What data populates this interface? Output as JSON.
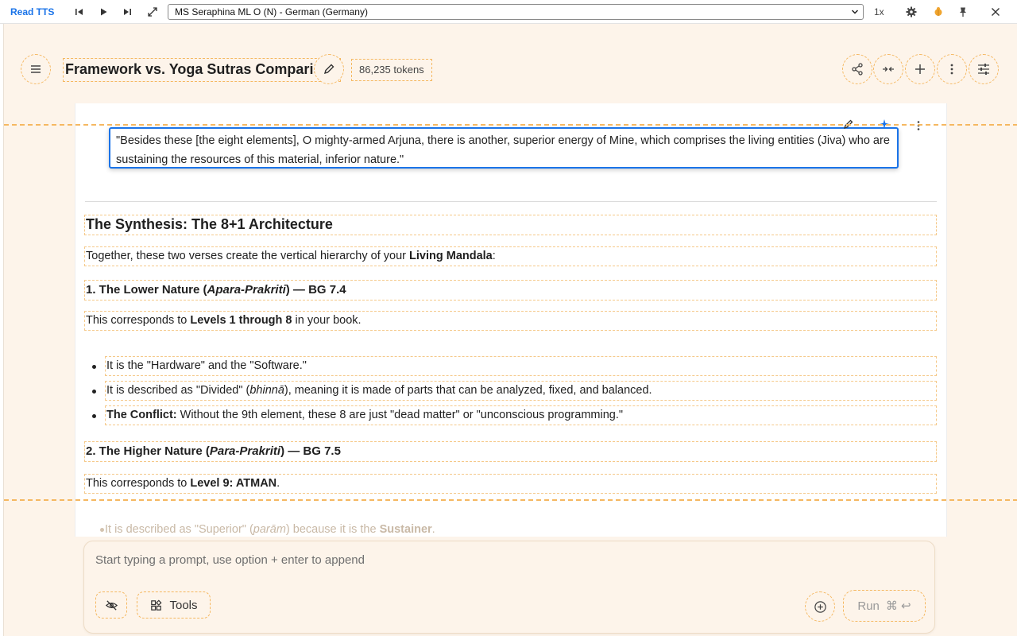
{
  "tts": {
    "title": "Read TTS",
    "voice": "MS Seraphina ML O (N) - German (Germany)",
    "speed": "1x"
  },
  "header": {
    "title": "Framework vs. Yoga Sutras Comparison",
    "tokens": "86,235 tokens"
  },
  "chat": {
    "quote": "\"Besides these [the eight elements], O mighty-armed Arjuna, there is another, superior energy of Mine, which comprises the living entities (Jiva) who are sustaining the resources of this material, inferior nature.\"",
    "section_heading": "The Synthesis: The 8+1 Architecture",
    "intro_text": "Together, these two verses create the vertical hierarchy of your ",
    "intro_bold": "Living Mandala",
    "intro_end": ":",
    "lower": {
      "heading_pre": "1. The Lower Nature (",
      "heading_em": "Apara-Prakriti",
      "heading_post": ") — BG 7.4",
      "corr_pre": "This corresponds to ",
      "corr_bold": "Levels 1 through 8",
      "corr_post": " in your book.",
      "bullets": [
        {
          "pre": "It is the \"Hardware\" and the \"Software.\"",
          "em": "",
          "bold": "",
          "post": ""
        },
        {
          "pre": "It is described as \"Divided\" (",
          "em": "bhinnā",
          "bold": "",
          "post": "), meaning it is made of parts that can be analyzed, fixed, and balanced."
        },
        {
          "pre": "",
          "em": "",
          "bold": "The Conflict:",
          "post": " Without the 9th element, these 8 are just \"dead matter\" or \"unconscious programming.\""
        }
      ]
    },
    "higher": {
      "heading_pre": "2. The Higher Nature (",
      "heading_em": "Para-Prakriti",
      "heading_post": ") — BG 7.5",
      "corr_pre": "This corresponds to ",
      "corr_bold": "Level 9: ATMAN",
      "corr_post": ".",
      "faded_pre": "It is described as \"Superior\" (",
      "faded_em": "parām",
      "faded_mid": ") because it is the ",
      "faded_bold": "Sustainer",
      "faded_post": "."
    }
  },
  "prompt": {
    "placeholder": "Start typing a prompt, use option + enter to append",
    "tools_label": "Tools",
    "run_label": "Run",
    "run_shortcut": "⌘ ↩"
  },
  "colors": {
    "accent": "#1a73e8",
    "dashed_outline": "#f5b861",
    "app_background": "#fdf4ea"
  },
  "icons": [
    "skip-back-icon",
    "play-icon",
    "skip-forward-icon",
    "expand-icon",
    "settings-icon",
    "bug-icon",
    "pin-icon",
    "close-icon",
    "menu-icon",
    "edit-icon",
    "share-icon",
    "compress-icon",
    "plus-icon",
    "more-vert-icon",
    "tune-icon",
    "eye-off-icon",
    "tools-icon",
    "add-circle-icon"
  ]
}
